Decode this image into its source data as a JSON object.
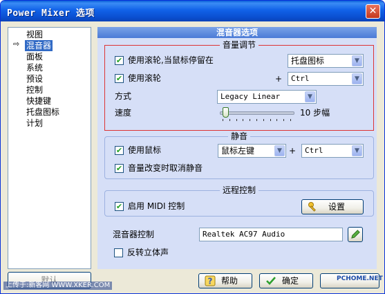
{
  "window": {
    "title": "Power Mixer 选项",
    "close_glyph": "✕"
  },
  "nav": {
    "items": [
      "视图",
      "混音器",
      "面板",
      "系统",
      "预设",
      "控制",
      "快捷键",
      "托盘图标",
      "计划"
    ],
    "selected_index": 1,
    "arrow_glyph": "⇨",
    "bottom_button": "默认"
  },
  "panel": {
    "title": "混音器选项"
  },
  "volume": {
    "legend": "音量调节",
    "wheel_hover_label": "使用滚轮,当鼠标停留在",
    "wheel_hover_checked": true,
    "wheel_hover_target": "托盘图标",
    "wheel_label": "使用滚轮",
    "wheel_checked": true,
    "plus": "+",
    "wheel_modifier": "Ctrl",
    "mode_label": "方式",
    "mode_value": "Legacy Linear",
    "speed_label": "速度",
    "speed_value": "10 步幅",
    "speed_fraction": 0.08
  },
  "mute": {
    "legend": "静音",
    "mouse_label": "使用鼠标",
    "mouse_checked": true,
    "mouse_button": "鼠标左键",
    "plus": "+",
    "mouse_modifier": "Ctrl",
    "unmute_label": "音量改变时取消静音",
    "unmute_checked": true
  },
  "remote": {
    "legend": "远程控制",
    "midi_label": "启用 MIDI 控制",
    "midi_checked": true,
    "settings_button": "设置"
  },
  "mixer_control": {
    "label": "混音器控制",
    "value": "Realtek AC97 Audio"
  },
  "reverse_stereo": {
    "label": "反转立体声",
    "checked": false
  },
  "buttons": {
    "help": "帮助",
    "ok": "确定"
  },
  "watermark": {
    "left": "上传于:新客网 WWW.XKER.COM",
    "right": "PCHOME.NET"
  },
  "check_glyph": "✔"
}
